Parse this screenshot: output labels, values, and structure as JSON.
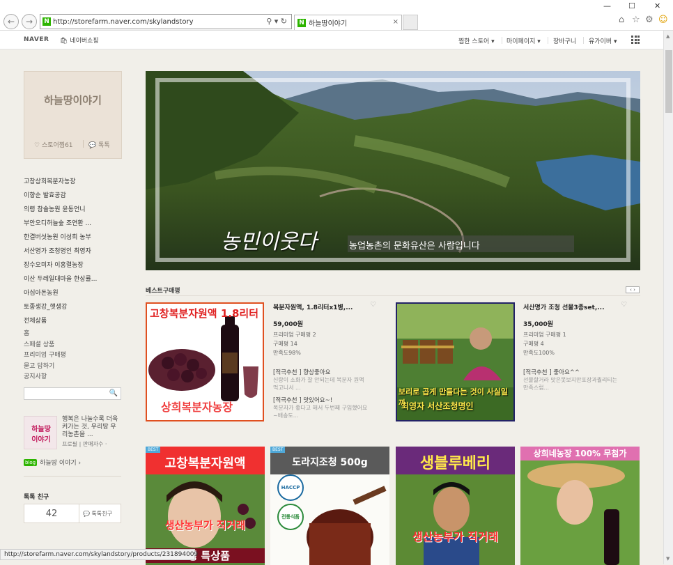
{
  "browser": {
    "url": "http://storefarm.naver.com/skylandstory",
    "tab_title": "하늘땅이야기",
    "tab_close": "×",
    "status_url": "http://storefarm.naver.com/skylandstory/products/231894009"
  },
  "gnb": {
    "naver": "NAVER",
    "shopping": "네이버쇼핑",
    "menu": [
      "찜한 스토어 ▾",
      "마이페이지 ▾",
      "장바구니",
      "유가이버 ▾"
    ]
  },
  "store": {
    "name": "하늘땅이야기",
    "zzim_label": "스토어찜61",
    "talk_label": "톡톡"
  },
  "categories": [
    "고창상희복분자농장",
    "이향순 발효공감",
    "의령 참솔농원 윤동언니",
    "부안오디허늘숲 조연환 ...",
    "한결버섯농원 이성희 농부",
    "서산명가 조청명인 최영자",
    "장수오미자 이홍렬농장",
    "이산 두레일대마을 한상률...",
    "아심아돈농원",
    "토종생강_햇생강",
    "전체상품"
  ],
  "sub_menu": [
    "홈",
    "스페셜 상품",
    "프리미엄 구매평",
    "묻고 답하기",
    "공지사항"
  ],
  "profile": {
    "thumb_line1": "하늘땅",
    "thumb_line2": "이야기",
    "desc": "행복은 나눌수록 더욱 커가는 것, 우리땅 우리농촌을 ...",
    "meta": "프로필 | 판매자수 ·",
    "blog_badge": "blog",
    "blog_label": "하늘땅 이야기 ›"
  },
  "talk_friend": {
    "title": "톡톡 친구",
    "count": "42",
    "add_label": "톡톡친구"
  },
  "banner": {
    "calligraphy": "농민이웃다",
    "caption": "농업농촌의 문화유산은 사람입니다"
  },
  "best": {
    "title": "베스트구매평",
    "paging": "‹ ›"
  },
  "products_top": [
    {
      "image_title": "고창복분자원액 1.8리터",
      "image_brand": "상희복분자농장",
      "title": "복분자원액, 1.8리터x1병,...",
      "price": "59,000원",
      "premium": "프리미엄 구매평 2",
      "reviews": "구매평 14",
      "satisfaction": "만족도98%",
      "r1_head": "[적극추천 ]  향상좋아요",
      "r1_text": "신랑이 소화가 잘 안되는데 복분자 원액 먹고니서 ...",
      "r2_head": "[적극추천 ]  맛있어요~!",
      "r2_text": "복분자가 좋다고 해서 두번째 구입했어요~배송도..."
    },
    {
      "image_title": "보리로 곱게 만들다는 것이 사실일까",
      "image_brand": "최영자 서산조청명인",
      "title": "서산명가 조청 선물3종set,...",
      "price": "35,000원",
      "premium": "프리미엄 구매평 1",
      "reviews": "구매평 4",
      "satisfaction": "만족도100%",
      "r1_head": "[적극추천 ]  좋아요^^",
      "r1_text": "선물할거라 맛은못보지만포장과퀄리티는만족스럽..."
    }
  ],
  "products_bottom": [
    {
      "badge": "BEST",
      "title": "고창복분자원액",
      "sub": "생산농부가 직거래",
      "foot": "2병 특상품"
    },
    {
      "badge": "BEST",
      "title": "도라지조청 500g",
      "haccp": "HACCP",
      "cert": "전통식품"
    },
    {
      "title": "생블루베리",
      "sub": "생산농부가 직거래"
    },
    {
      "title": "상희네농장 100% 무첨가"
    }
  ],
  "colors": {
    "accent_green": "#2db400",
    "sale_red": "#e02020"
  }
}
